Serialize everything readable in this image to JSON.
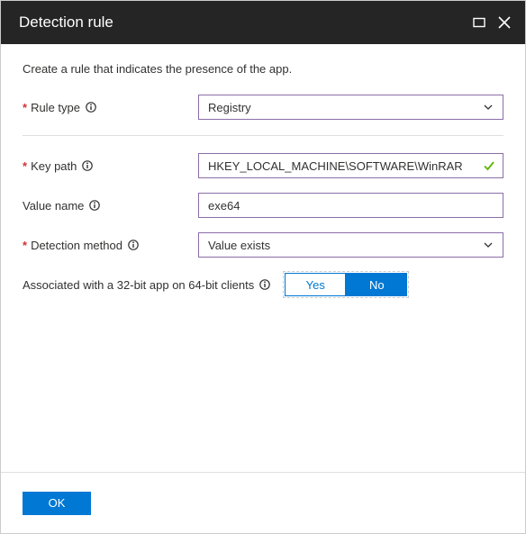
{
  "header": {
    "title": "Detection rule"
  },
  "description": "Create a rule that indicates the presence of the app.",
  "fields": {
    "ruleType": {
      "label": "Rule type",
      "value": "Registry"
    },
    "keyPath": {
      "label": "Key path",
      "value": "HKEY_LOCAL_MACHINE\\SOFTWARE\\WinRAR"
    },
    "valueName": {
      "label": "Value name",
      "value": "exe64"
    },
    "detectionMethod": {
      "label": "Detection method",
      "value": "Value exists"
    },
    "associated": {
      "label": "Associated with a 32-bit app on 64-bit clients",
      "yes": "Yes",
      "no": "No",
      "selected": "No"
    }
  },
  "footer": {
    "ok": "OK"
  }
}
